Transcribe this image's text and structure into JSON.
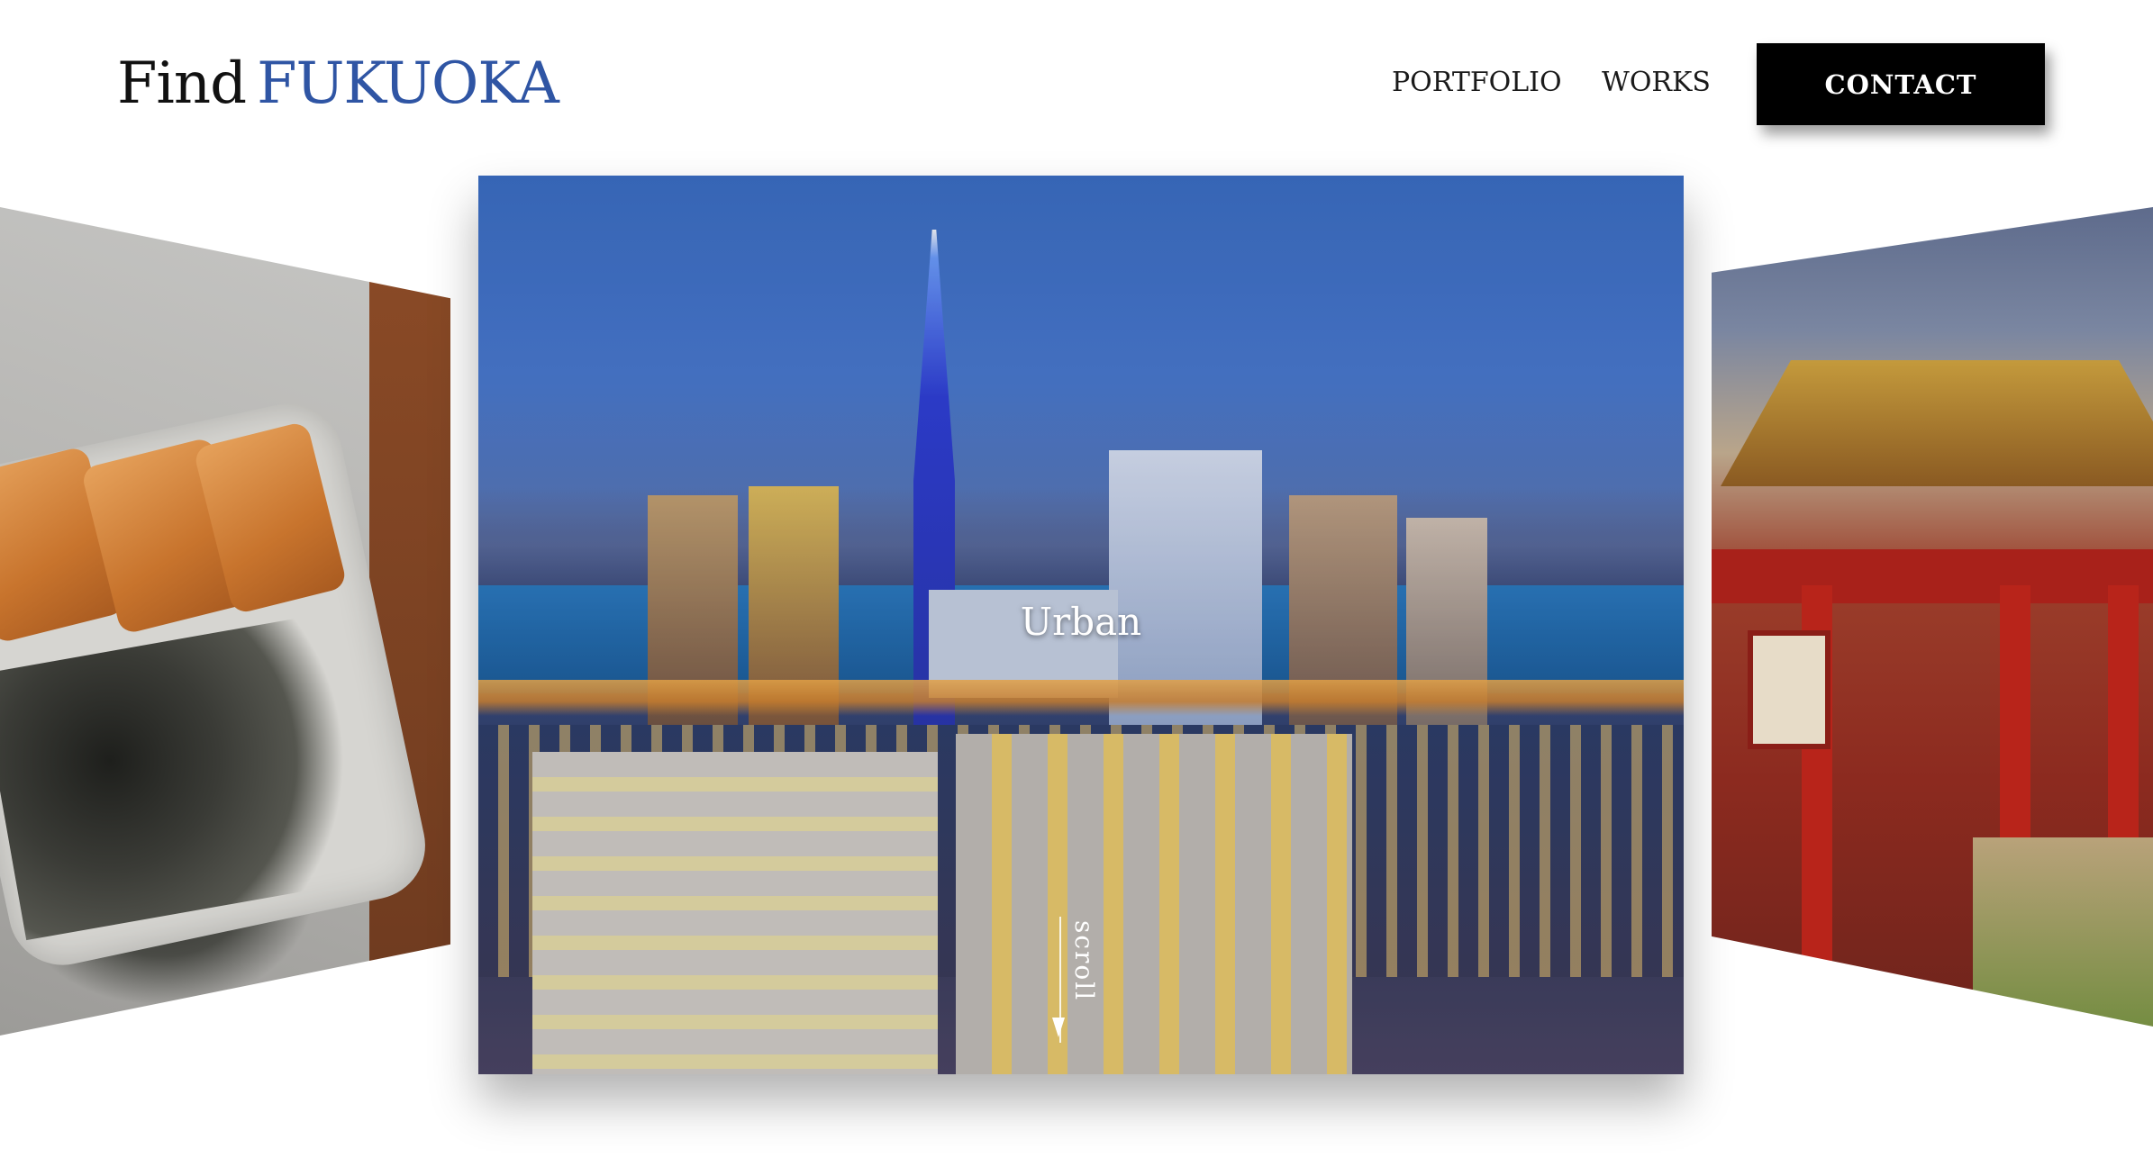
{
  "header": {
    "logo_find": "Find",
    "logo_city": "FUKUOKA",
    "nav": {
      "portfolio": "PORTFOLIO",
      "works": "WORKS",
      "contact": "CONTACT"
    }
  },
  "carousel": {
    "active_slide": {
      "title": "Urban",
      "scroll_label": "scroll"
    },
    "colors": {
      "brand_blue": "#2f55a4",
      "contact_bg": "#000000"
    }
  }
}
